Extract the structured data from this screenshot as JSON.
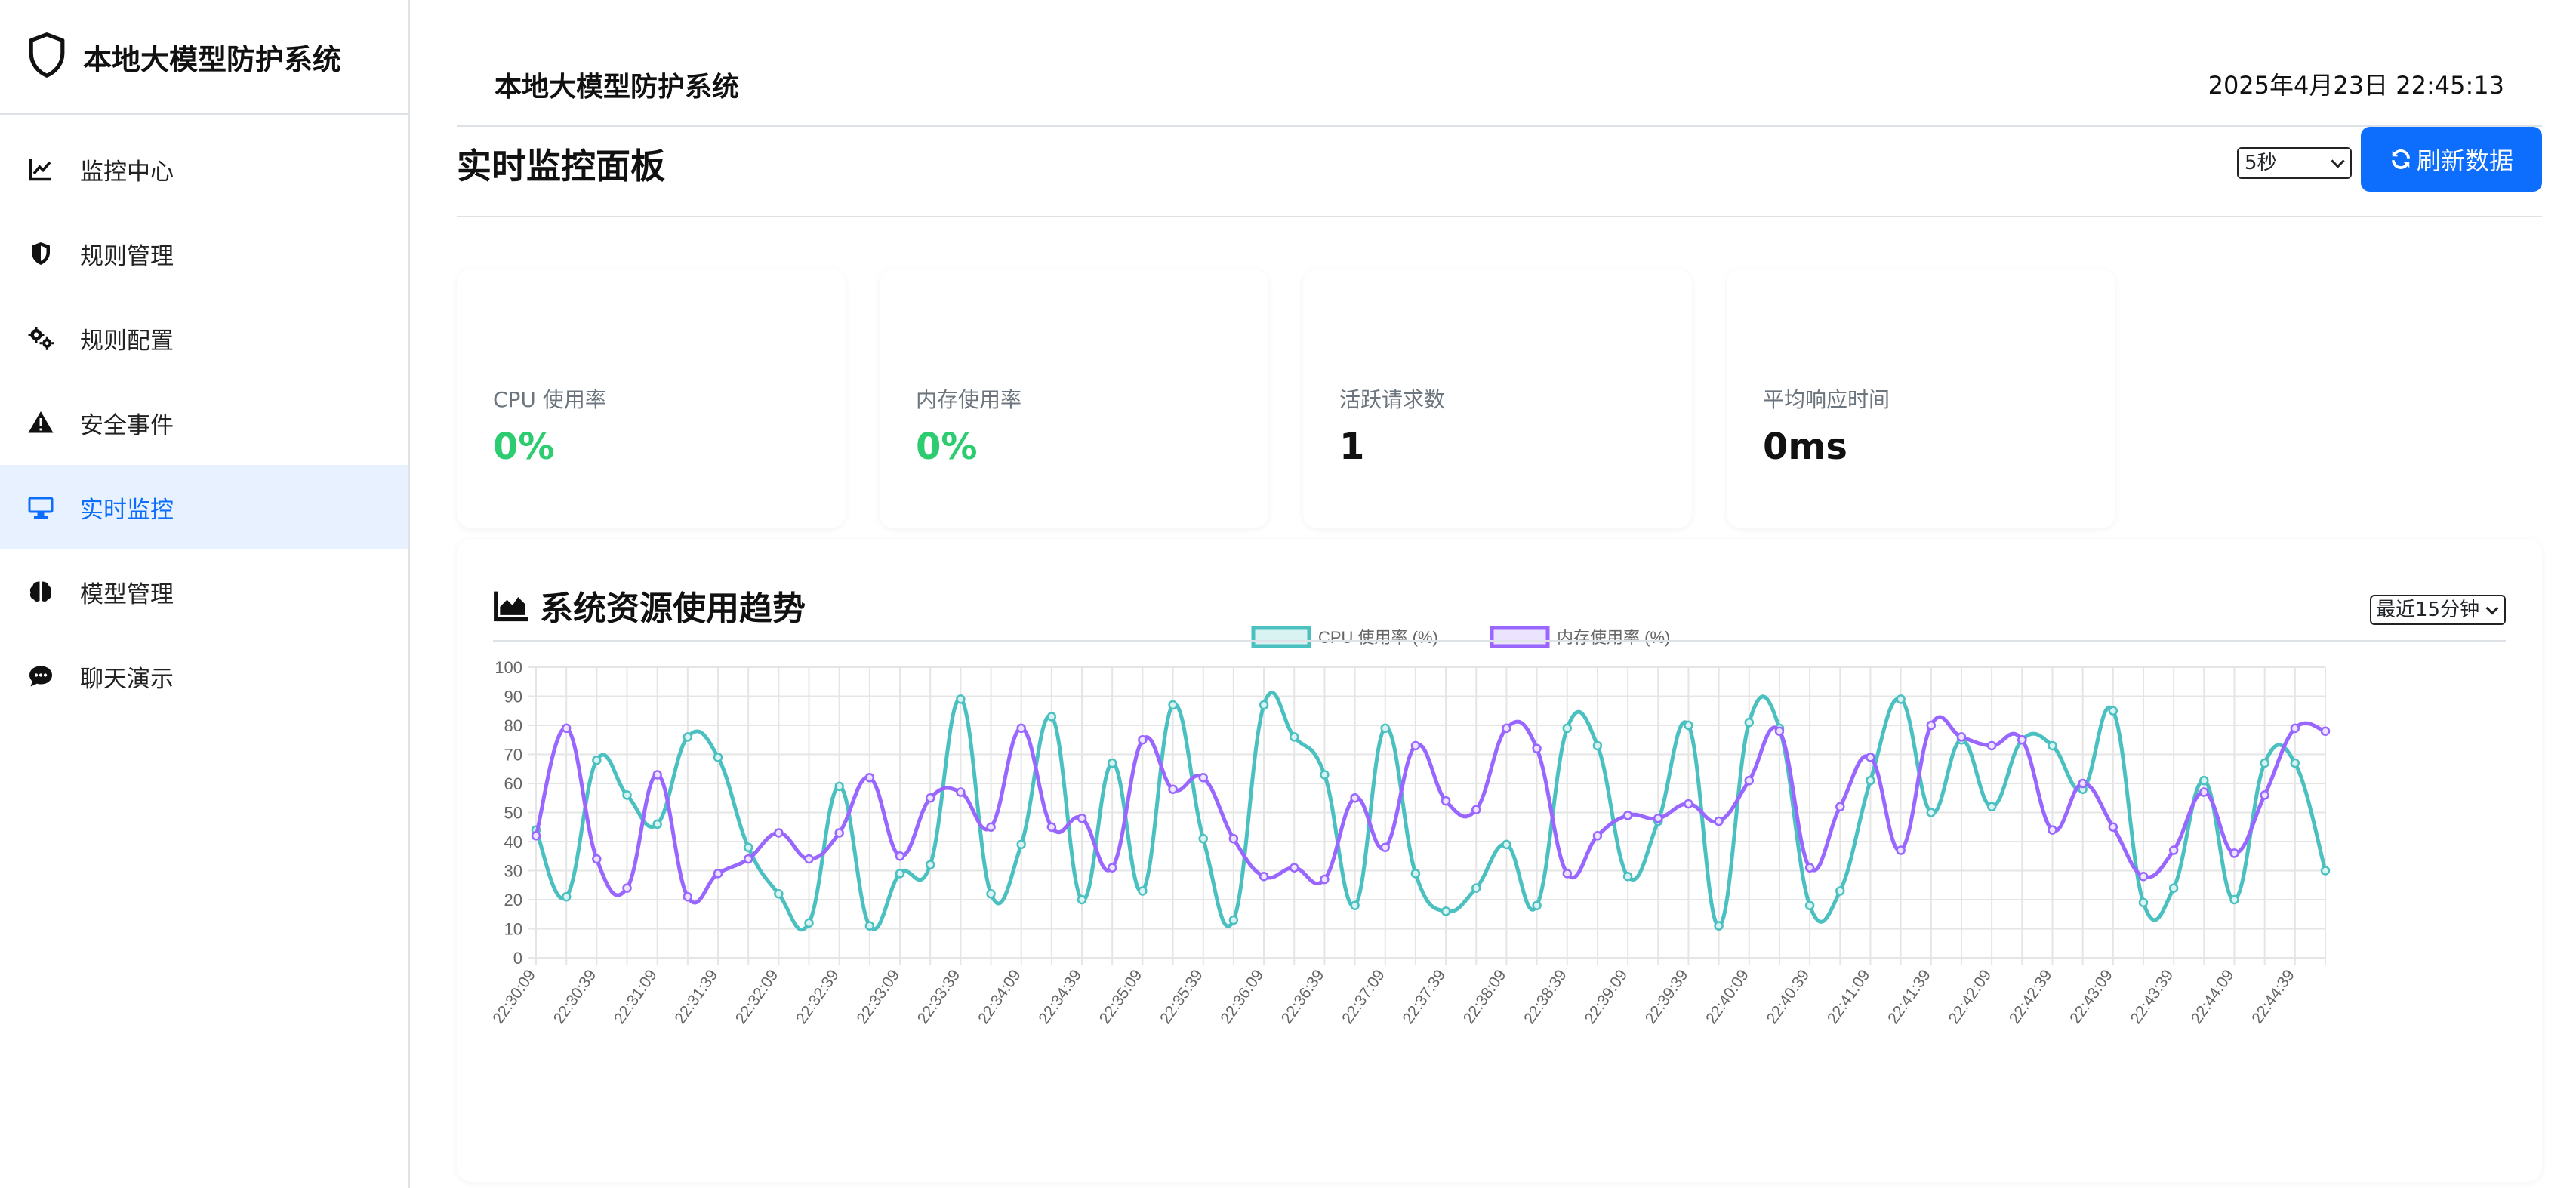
{
  "sidebar": {
    "brand": "本地大模型防护系统",
    "items": [
      {
        "label": "监控中心",
        "icon": "chart-line-icon"
      },
      {
        "label": "规则管理",
        "icon": "shield-half-icon"
      },
      {
        "label": "规则配置",
        "icon": "gears-icon"
      },
      {
        "label": "安全事件",
        "icon": "warning-icon"
      },
      {
        "label": "实时监控",
        "icon": "monitor-icon",
        "active": true
      },
      {
        "label": "模型管理",
        "icon": "brain-icon"
      },
      {
        "label": "聊天演示",
        "icon": "chat-icon"
      }
    ]
  },
  "header": {
    "title": "本地大模型防护系统",
    "datetime": "2025年4月23日 22:45:13"
  },
  "panel": {
    "title": "实时监控面板",
    "interval": "5秒",
    "refresh_label": "刷新数据"
  },
  "stats": [
    {
      "label": "CPU 使用率",
      "value": "0%"
    },
    {
      "label": "内存使用率",
      "value": "0%"
    },
    {
      "label": "活跃请求数",
      "value": "1"
    },
    {
      "label": "平均响应时间",
      "value": "0ms"
    }
  ],
  "colors": {
    "primary": "#0d6efd",
    "ok": "#2ecc71",
    "cpu": "#4bc0c0",
    "mem": "#9966ff"
  },
  "chart_section": {
    "title": "系统资源使用趋势",
    "range": "最近15分钟"
  },
  "chart_data": {
    "type": "line",
    "ylim": [
      0,
      100
    ],
    "yticks": [
      0,
      10,
      20,
      30,
      40,
      50,
      60,
      70,
      80,
      90,
      100
    ],
    "grid": true,
    "legend": "top-center",
    "x": [
      "22:30:09",
      "22:30:24",
      "22:30:39",
      "22:30:54",
      "22:31:09",
      "22:31:24",
      "22:31:39",
      "22:31:54",
      "22:32:09",
      "22:32:24",
      "22:32:39",
      "22:32:54",
      "22:33:09",
      "22:33:24",
      "22:33:39",
      "22:33:54",
      "22:34:09",
      "22:34:24",
      "22:34:39",
      "22:34:54",
      "22:35:09",
      "22:35:24",
      "22:35:39",
      "22:35:54",
      "22:36:09",
      "22:36:24",
      "22:36:39",
      "22:36:54",
      "22:37:09",
      "22:37:24",
      "22:37:39",
      "22:37:54",
      "22:38:09",
      "22:38:24",
      "22:38:39",
      "22:38:54",
      "22:39:09",
      "22:39:24",
      "22:39:39",
      "22:39:54",
      "22:40:09",
      "22:40:24",
      "22:40:39",
      "22:40:54",
      "22:41:09",
      "22:41:24",
      "22:41:39",
      "22:41:54",
      "22:42:09",
      "22:42:24",
      "22:42:39",
      "22:42:54",
      "22:43:09",
      "22:43:24",
      "22:43:39",
      "22:43:54",
      "22:44:09",
      "22:44:24",
      "22:44:39",
      "22:44:54"
    ],
    "xtick_labels": [
      "22:30:09",
      "22:30:39",
      "22:31:09",
      "22:31:39",
      "22:32:09",
      "22:32:39",
      "22:33:09",
      "22:33:39",
      "22:34:09",
      "22:34:39",
      "22:35:09",
      "22:35:39",
      "22:36:09",
      "22:36:39",
      "22:37:09",
      "22:37:39",
      "22:38:09",
      "22:38:39",
      "22:39:09",
      "22:39:39",
      "22:40:09",
      "22:40:39",
      "22:41:09",
      "22:41:39",
      "22:42:09",
      "22:42:39",
      "22:43:09",
      "22:43:39",
      "22:44:09",
      "22:44:39"
    ],
    "series": [
      {
        "name": "CPU 使用率 (%)",
        "color": "#4bc0c0",
        "values": [
          44,
          21,
          68,
          56,
          46,
          76,
          69,
          38,
          22,
          12,
          59,
          11,
          29,
          32,
          89,
          22,
          39,
          83,
          20,
          67,
          23,
          87,
          41,
          13,
          87,
          76,
          63,
          18,
          79,
          29,
          16,
          24,
          39,
          18,
          79,
          73,
          28,
          47,
          80,
          11,
          81,
          79,
          18,
          23,
          61,
          89,
          50,
          75,
          52,
          75,
          73,
          58,
          85,
          19,
          24,
          61,
          20,
          67,
          67,
          30
        ]
      },
      {
        "name": "内存使用率 (%)",
        "color": "#9966ff",
        "values": [
          42,
          79,
          34,
          24,
          63,
          21,
          29,
          34,
          43,
          34,
          43,
          62,
          35,
          55,
          57,
          45,
          79,
          45,
          48,
          31,
          75,
          58,
          62,
          41,
          28,
          31,
          27,
          55,
          38,
          73,
          54,
          51,
          79,
          72,
          29,
          42,
          49,
          48,
          53,
          47,
          61,
          78,
          31,
          52,
          69,
          37,
          80,
          76,
          73,
          75,
          44,
          60,
          45,
          28,
          37,
          57,
          36,
          56,
          79,
          78
        ]
      }
    ]
  }
}
